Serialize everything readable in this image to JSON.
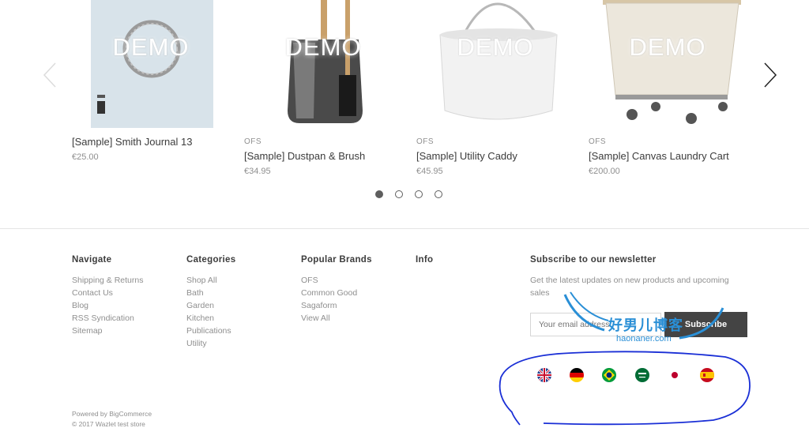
{
  "carousel": {
    "watermark": "DEMO",
    "products": [
      {
        "brand": "",
        "title": "[Sample] Smith Journal 13",
        "price": "€25.00"
      },
      {
        "brand": "OFS",
        "title": "[Sample] Dustpan & Brush",
        "price": "€34.95"
      },
      {
        "brand": "OFS",
        "title": "[Sample] Utility Caddy",
        "price": "€45.95"
      },
      {
        "brand": "OFS",
        "title": "[Sample] Canvas Laundry Cart",
        "price": "€200.00"
      }
    ],
    "active_page": 1,
    "page_count": 4
  },
  "footer": {
    "navigate": {
      "title": "Navigate",
      "links": [
        "Shipping & Returns",
        "Contact Us",
        "Blog",
        "RSS Syndication",
        "Sitemap"
      ]
    },
    "categories": {
      "title": "Categories",
      "links": [
        "Shop All",
        "Bath",
        "Garden",
        "Kitchen",
        "Publications",
        "Utility"
      ]
    },
    "brands": {
      "title": "Popular Brands",
      "links": [
        "OFS",
        "Common Good",
        "Sagaform",
        "View All"
      ]
    },
    "info": {
      "title": "Info"
    },
    "newsletter": {
      "title": "Subscribe to our newsletter",
      "description": "Get the latest updates on new products and upcoming sales",
      "email_placeholder": "Your email address",
      "button_label": "Subscribe"
    },
    "flags": [
      "united-kingdom-flag",
      "germany-flag",
      "brazil-flag",
      "saudi-arabia-flag",
      "japan-flag",
      "spain-flag"
    ],
    "powered_by": "Powered by BigCommerce",
    "copyright": "© 2017 Wazlet test store"
  },
  "watermark_overlay": {
    "text": "好男儿博客",
    "sub": "haonaner.com"
  },
  "colors": {
    "accent": "#444444",
    "annotation": "#1a2fd6",
    "watermark": "#2a8fd6"
  }
}
